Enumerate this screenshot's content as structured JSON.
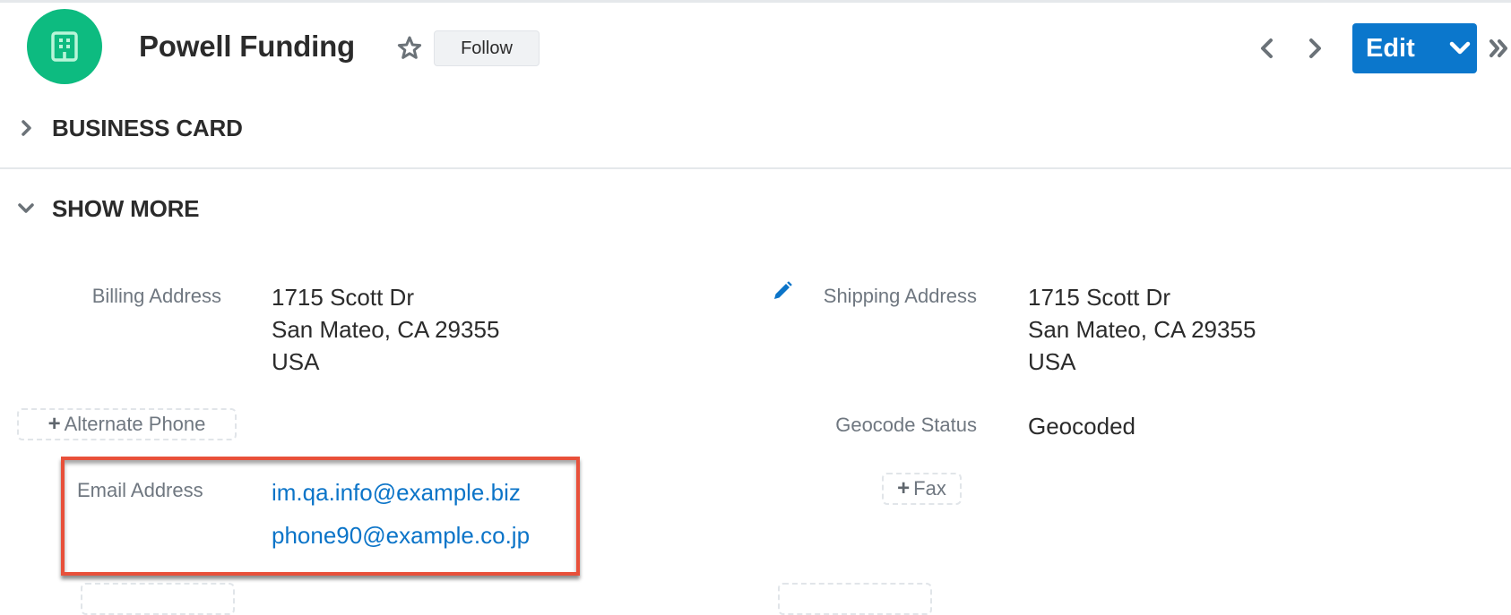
{
  "header": {
    "record_title": "Powell Funding",
    "avatar_icon": "building-icon",
    "avatar_color": "#0dbb80",
    "favorite_icon": "star-outline-icon",
    "follow_label": "Follow",
    "prev_icon": "chevron-left-icon",
    "next_icon": "chevron-right-icon",
    "edit_label": "Edit",
    "edit_menu_icon": "chevron-down-icon",
    "more_icon": "double-chevron-right-icon",
    "accent_color": "#0b77cc"
  },
  "panels": [
    {
      "label": "BUSINESS CARD",
      "state": "collapsed",
      "icon": "chevron-right-icon"
    },
    {
      "label": "SHOW MORE",
      "state": "expanded",
      "icon": "chevron-down-icon"
    }
  ],
  "fields": {
    "billing_address": {
      "label": "Billing Address",
      "lines": [
        "1715 Scott Dr",
        "San Mateo, CA 29355",
        "USA"
      ]
    },
    "shipping_address": {
      "label": "Shipping Address",
      "edit_icon": "pencil-icon",
      "lines": [
        "1715 Scott Dr",
        "San Mateo, CA 29355",
        "USA"
      ]
    },
    "alternate_phone": {
      "add_label": "Alternate Phone",
      "icon": "plus-icon"
    },
    "geocode_status": {
      "label": "Geocode Status",
      "value": "Geocoded"
    },
    "email_address": {
      "label": "Email Address",
      "values": [
        "im.qa.info@example.biz",
        "phone90@example.co.jp"
      ],
      "highlight_color": "#e8503a"
    },
    "fax": {
      "add_label": "Fax",
      "icon": "plus-icon"
    }
  }
}
